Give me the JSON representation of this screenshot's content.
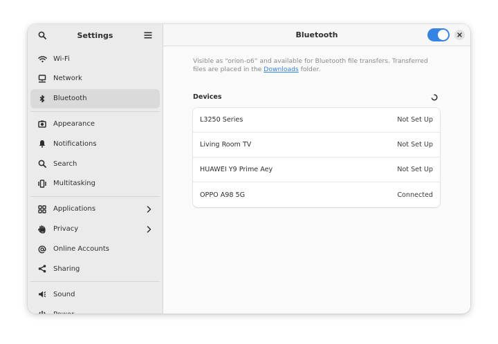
{
  "sidebar": {
    "title": "Settings",
    "groups": [
      [
        {
          "label": "Wi-Fi",
          "icon": "wifi-icon"
        },
        {
          "label": "Network",
          "icon": "network-icon"
        },
        {
          "label": "Bluetooth",
          "icon": "bluetooth-icon",
          "active": true
        }
      ],
      [
        {
          "label": "Appearance",
          "icon": "appearance-icon"
        },
        {
          "label": "Notifications",
          "icon": "bell-icon"
        },
        {
          "label": "Search",
          "icon": "search-icon"
        },
        {
          "label": "Multitasking",
          "icon": "multitasking-icon"
        }
      ],
      [
        {
          "label": "Applications",
          "icon": "applications-icon",
          "chevron": true
        },
        {
          "label": "Privacy",
          "icon": "privacy-hand-icon",
          "chevron": true
        },
        {
          "label": "Online Accounts",
          "icon": "at-icon"
        },
        {
          "label": "Sharing",
          "icon": "share-icon"
        }
      ],
      [
        {
          "label": "Sound",
          "icon": "speaker-icon"
        },
        {
          "label": "Power",
          "icon": "power-icon"
        }
      ]
    ]
  },
  "main": {
    "title": "Bluetooth",
    "toggle_on": true,
    "description_pre": "Visible as “orion-o6” and available for Bluetooth file transfers. Transferred files are placed in the ",
    "description_link": "Downloads",
    "description_post": " folder.",
    "devices_title": "Devices",
    "devices": [
      {
        "name": "L3250 Series",
        "status": "Not Set Up"
      },
      {
        "name": "Living Room TV",
        "status": "Not Set Up"
      },
      {
        "name": "HUAWEI Y9 Prime Aey",
        "status": "Not Set Up"
      },
      {
        "name": "OPPO A98 5G",
        "status": "Connected"
      }
    ]
  },
  "colors": {
    "accent": "#3584e4",
    "sidebar_bg": "#ebebeb",
    "content_bg": "#fafafa"
  }
}
